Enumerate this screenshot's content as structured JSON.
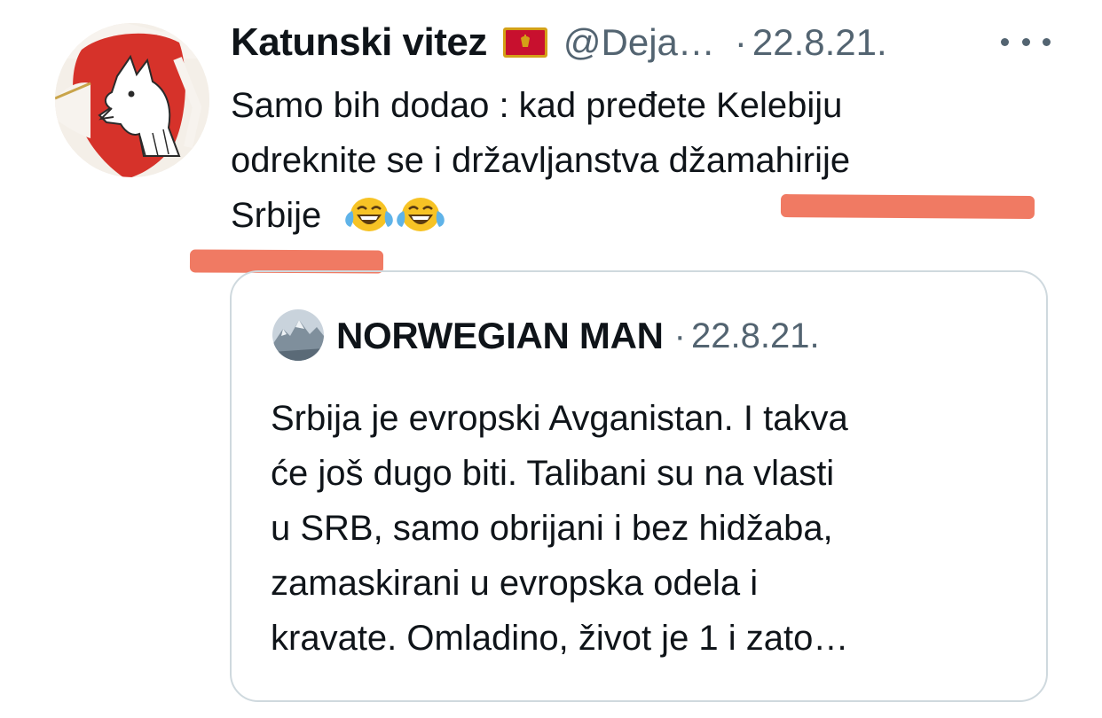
{
  "tweet": {
    "author": {
      "display_name": "Katunski vitez",
      "flag_icon": "montenegro-flag-icon",
      "handle": "@Deja…",
      "separator": "·",
      "date": "22.8.21."
    },
    "text_lines": [
      "Samo bih dodao : kad pređete Kelebiju",
      "odreknite se i državljanstva džamahirije",
      "Srbije"
    ],
    "emojis": [
      "face-with-tears-of-joy",
      "face-with-tears-of-joy"
    ],
    "highlight_color": "#f07a63"
  },
  "quoted_tweet": {
    "author": {
      "display_name": "NORWEGIAN MAN",
      "separator": "·",
      "date": "22.8.21."
    },
    "text_lines": [
      "Srbija je evropski Avganistan. I takva",
      "će još dugo biti. Talibani su na vlasti",
      "u SRB, samo obrijani i bez hidžaba,",
      "zamaskirani u evropska odela i",
      "kravate. Omladino, život je 1 i zato…"
    ]
  },
  "colors": {
    "text": "#0f1419",
    "secondary": "#536471",
    "border": "#cfd9de",
    "avatar_red": "#d6322a"
  }
}
